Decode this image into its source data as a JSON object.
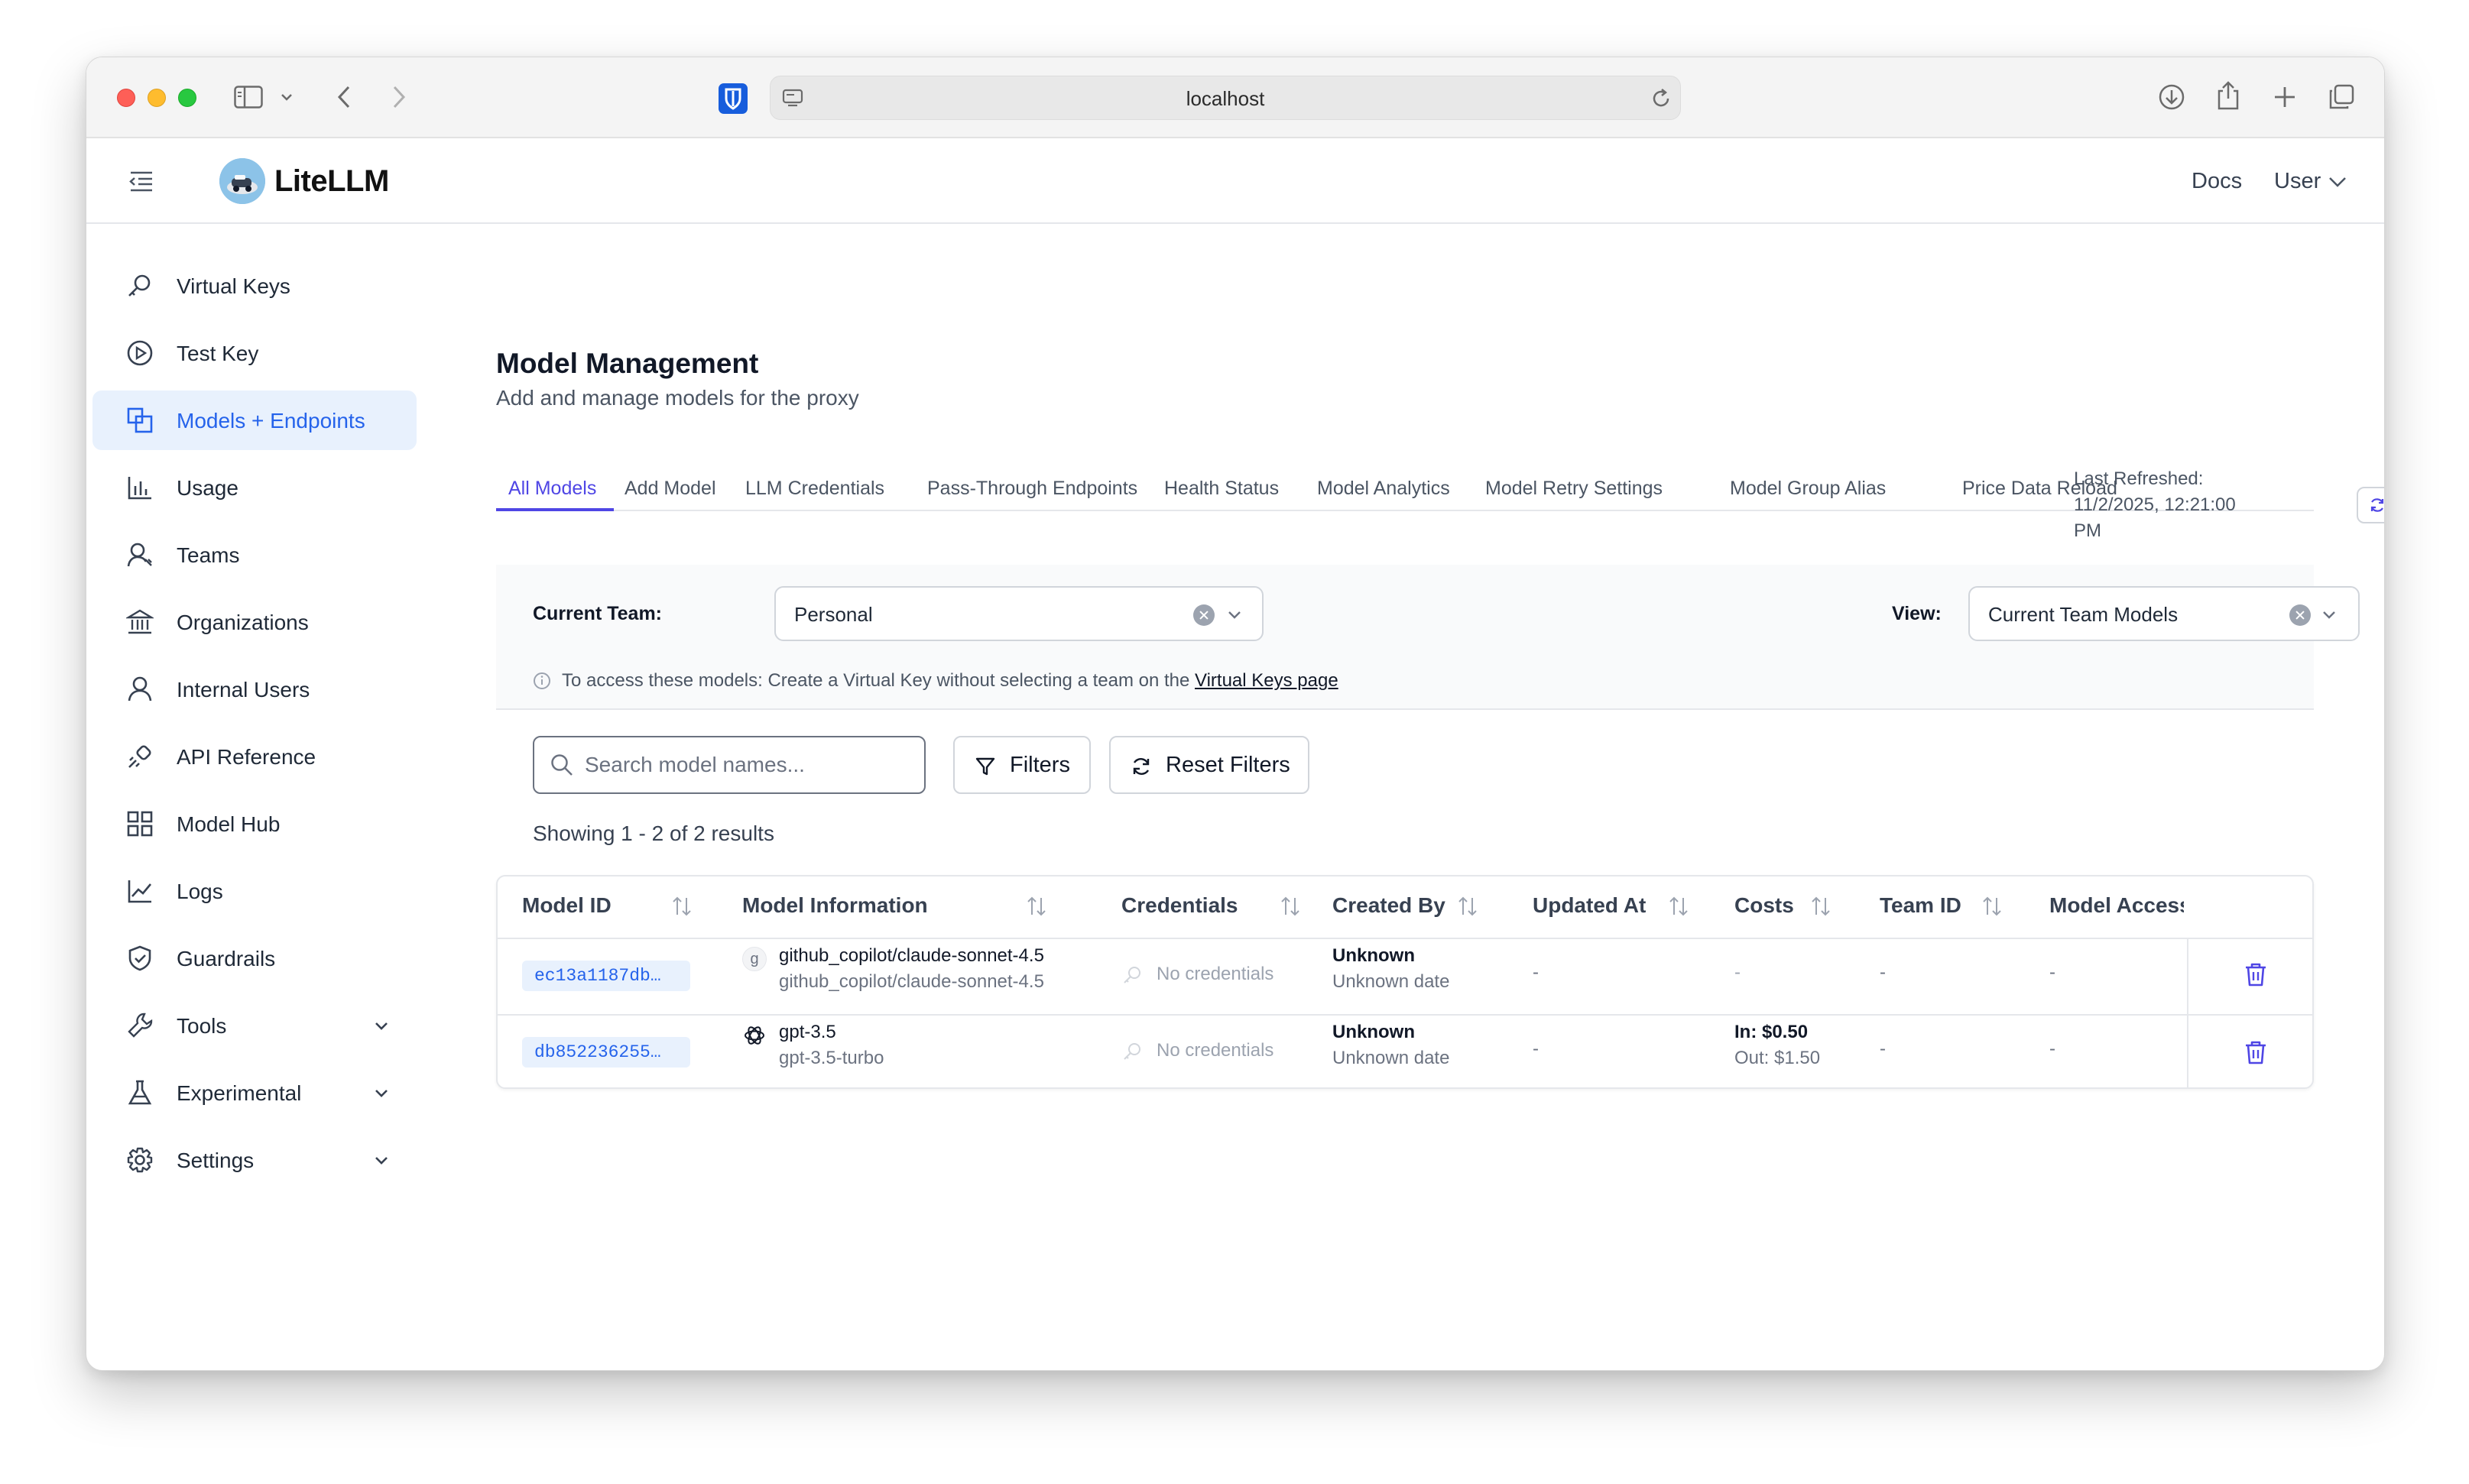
{
  "browser": {
    "url": "localhost"
  },
  "app": {
    "name": "LiteLLM",
    "docs_label": "Docs",
    "user_label": "User"
  },
  "sidebar": {
    "items": [
      {
        "label": "Virtual Keys",
        "icon": "key-icon"
      },
      {
        "label": "Test Key",
        "icon": "play-circle-icon"
      },
      {
        "label": "Models + Endpoints",
        "icon": "block-icon",
        "active": true
      },
      {
        "label": "Usage",
        "icon": "bar-chart-icon"
      },
      {
        "label": "Teams",
        "icon": "team-icon"
      },
      {
        "label": "Organizations",
        "icon": "bank-icon"
      },
      {
        "label": "Internal Users",
        "icon": "user-icon"
      },
      {
        "label": "API Reference",
        "icon": "api-icon"
      },
      {
        "label": "Model Hub",
        "icon": "appstore-icon"
      },
      {
        "label": "Logs",
        "icon": "line-chart-icon"
      },
      {
        "label": "Guardrails",
        "icon": "safety-icon"
      },
      {
        "label": "Tools",
        "icon": "tool-icon",
        "expandable": true
      },
      {
        "label": "Experimental",
        "icon": "experiment-icon",
        "expandable": true
      },
      {
        "label": "Settings",
        "icon": "setting-icon",
        "expandable": true
      }
    ]
  },
  "page": {
    "title": "Model Management",
    "subtitle": "Add and manage models for the proxy"
  },
  "tabs": [
    {
      "label": "All Models",
      "active": true
    },
    {
      "label": "Add Model"
    },
    {
      "label": "LLM Credentials"
    },
    {
      "label": "Pass-Through Endpoints"
    },
    {
      "label": "Health Status"
    },
    {
      "label": "Model Analytics"
    },
    {
      "label": "Model Retry Settings"
    },
    {
      "label": "Model Group Alias"
    },
    {
      "label": "Price Data Reload"
    }
  ],
  "refresh": {
    "label": "Last Refreshed:",
    "value": "11/2/2025, 12:21:00 PM"
  },
  "team_filter": {
    "label": "Current Team:",
    "value": "Personal",
    "view_label": "View:",
    "view_value": "Current Team Models",
    "info_text": "To access these models: Create a Virtual Key without selecting a team on the",
    "info_link": "Virtual Keys page"
  },
  "search": {
    "placeholder": "Search model names...",
    "filters_label": "Filters",
    "reset_label": "Reset Filters"
  },
  "results": {
    "text": "Showing 1 - 2 of 2 results"
  },
  "table": {
    "headers": [
      "Model ID",
      "Model Information",
      "Credentials",
      "Created By",
      "Updated At",
      "Costs",
      "Team ID",
      "Model Access"
    ],
    "rows": [
      {
        "model_id": "ec13a1187db…",
        "provider_letter": "g",
        "model_name": "github_copilot/claude-sonnet-4.5",
        "model_detail": "github_copilot/claude-sonnet-4.5",
        "credentials": "No credentials",
        "created_by": "Unknown",
        "created_date": "Unknown date",
        "updated_at": "-",
        "cost_in": "-",
        "cost_out": "",
        "team_id": "-",
        "model_access": "-"
      },
      {
        "model_id": "db852236255…",
        "provider_letter": "",
        "model_name": "gpt-3.5",
        "model_detail": "gpt-3.5-turbo",
        "credentials": "No credentials",
        "created_by": "Unknown",
        "created_date": "Unknown date",
        "updated_at": "-",
        "cost_in": "In: $0.50",
        "cost_out": "Out: $1.50",
        "team_id": "-",
        "model_access": "-"
      }
    ]
  },
  "colors": {
    "accent": "#4f46e5",
    "link": "#2563eb",
    "active_bg": "#e8f1fd"
  }
}
